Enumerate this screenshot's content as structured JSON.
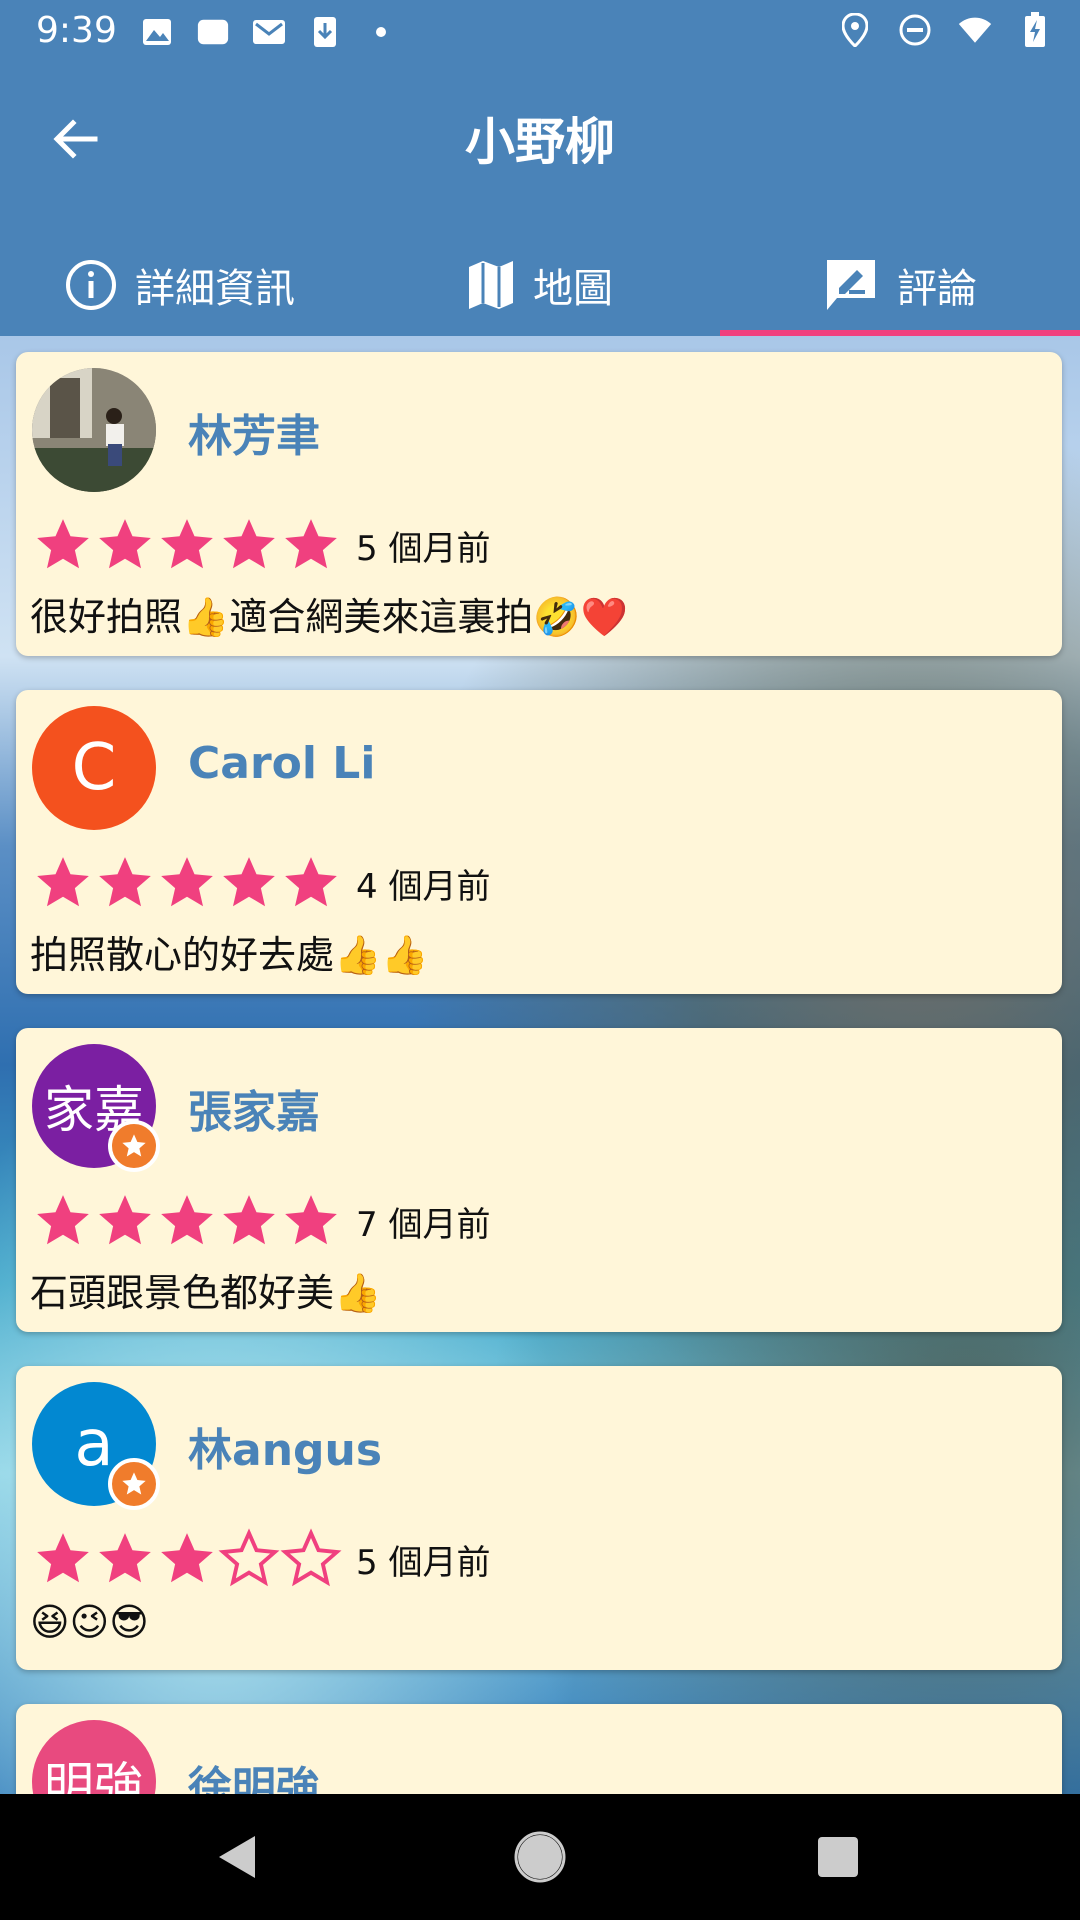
{
  "status_bar": {
    "time": "9:39",
    "left_icons": [
      "image-icon",
      "cloud-icon",
      "gmail-icon",
      "download-icon",
      "dot-icon"
    ],
    "right_icons": [
      "location-icon",
      "dnd-icon",
      "wifi-icon",
      "battery-charging-icon"
    ]
  },
  "app_bar": {
    "title": "小野柳",
    "tabs": [
      {
        "label": "詳細資訊",
        "icon": "info-icon",
        "selected": false
      },
      {
        "label": "地圖",
        "icon": "map-icon",
        "selected": false
      },
      {
        "label": "評論",
        "icon": "review-icon",
        "selected": true
      }
    ],
    "accent": "#f0407f",
    "background": "#4a83b8"
  },
  "reviews": [
    {
      "name": "林芳聿",
      "avatar_type": "photo",
      "avatar_color": "#6a6a6a",
      "avatar_text": "",
      "badge": false,
      "rating": 5,
      "time": "5 個月前",
      "text": "很好拍照👍適合網美來這裏拍🤣❤️"
    },
    {
      "name": "Carol Li",
      "avatar_type": "letter",
      "avatar_color": "#f4511e",
      "avatar_text": "C",
      "badge": false,
      "rating": 5,
      "time": "4 個月前",
      "text": "拍照散心的好去處👍👍"
    },
    {
      "name": "張家嘉",
      "avatar_type": "cjk",
      "avatar_color": "#7b1fa2",
      "avatar_text": "家嘉",
      "badge": true,
      "rating": 5,
      "time": "7 個月前",
      "text": "石頭跟景色都好美👍"
    },
    {
      "name": "林angus",
      "avatar_type": "letter",
      "avatar_color": "#0288d1",
      "avatar_text": "a",
      "badge": true,
      "rating": 3,
      "time": "5 個月前",
      "text": "😆😉😎"
    },
    {
      "name": "徐明強",
      "avatar_type": "cjk",
      "avatar_color": "#e84a7f",
      "avatar_text": "明強",
      "badge": false,
      "rating": null,
      "time": "",
      "text": ""
    }
  ],
  "colors": {
    "card_bg": "#fff6d9",
    "name": "#4a83b8",
    "star": "#f0407f"
  },
  "nav_bar": {
    "buttons": [
      "back-nav-icon",
      "home-nav-icon",
      "recents-nav-icon"
    ]
  }
}
